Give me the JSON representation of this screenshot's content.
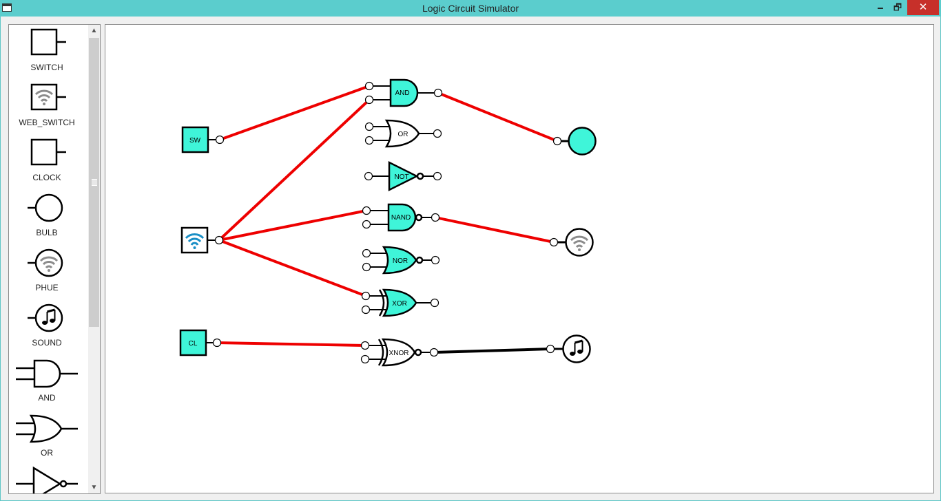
{
  "window": {
    "title": "Logic Circuit Simulator",
    "minimize_label": "🗕",
    "maximize_label": "🗗",
    "close_label": "✕"
  },
  "palette": {
    "items": [
      {
        "label": "SWITCH",
        "icon": "switch-icon"
      },
      {
        "label": "WEB_SWITCH",
        "icon": "wifi-switch-icon"
      },
      {
        "label": "CLOCK",
        "icon": "clock-icon"
      },
      {
        "label": "BULB",
        "icon": "bulb-icon"
      },
      {
        "label": "PHUE",
        "icon": "wifi-bulb-icon"
      },
      {
        "label": "SOUND",
        "icon": "music-note-icon"
      },
      {
        "label": "AND",
        "icon": "and-gate-icon"
      },
      {
        "label": "OR",
        "icon": "or-gate-icon"
      },
      {
        "label": "",
        "icon": "not-gate-icon"
      }
    ],
    "scroll_up": "▲",
    "scroll_down": "▼"
  },
  "circuit": {
    "inputs": {
      "switch": "SW",
      "clock": "CL"
    },
    "gates": {
      "and": "AND",
      "or": "OR",
      "not": "NOT",
      "nand": "NAND",
      "nor": "NOR",
      "xor": "XOR",
      "xnor": "XNOR"
    },
    "colors": {
      "accent": "#3ff5d9",
      "active_wire": "#ee0000",
      "inactive_wire": "#000000",
      "wifi_blue": "#1a8fc6",
      "wifi_gray": "#8c8c8c"
    }
  }
}
